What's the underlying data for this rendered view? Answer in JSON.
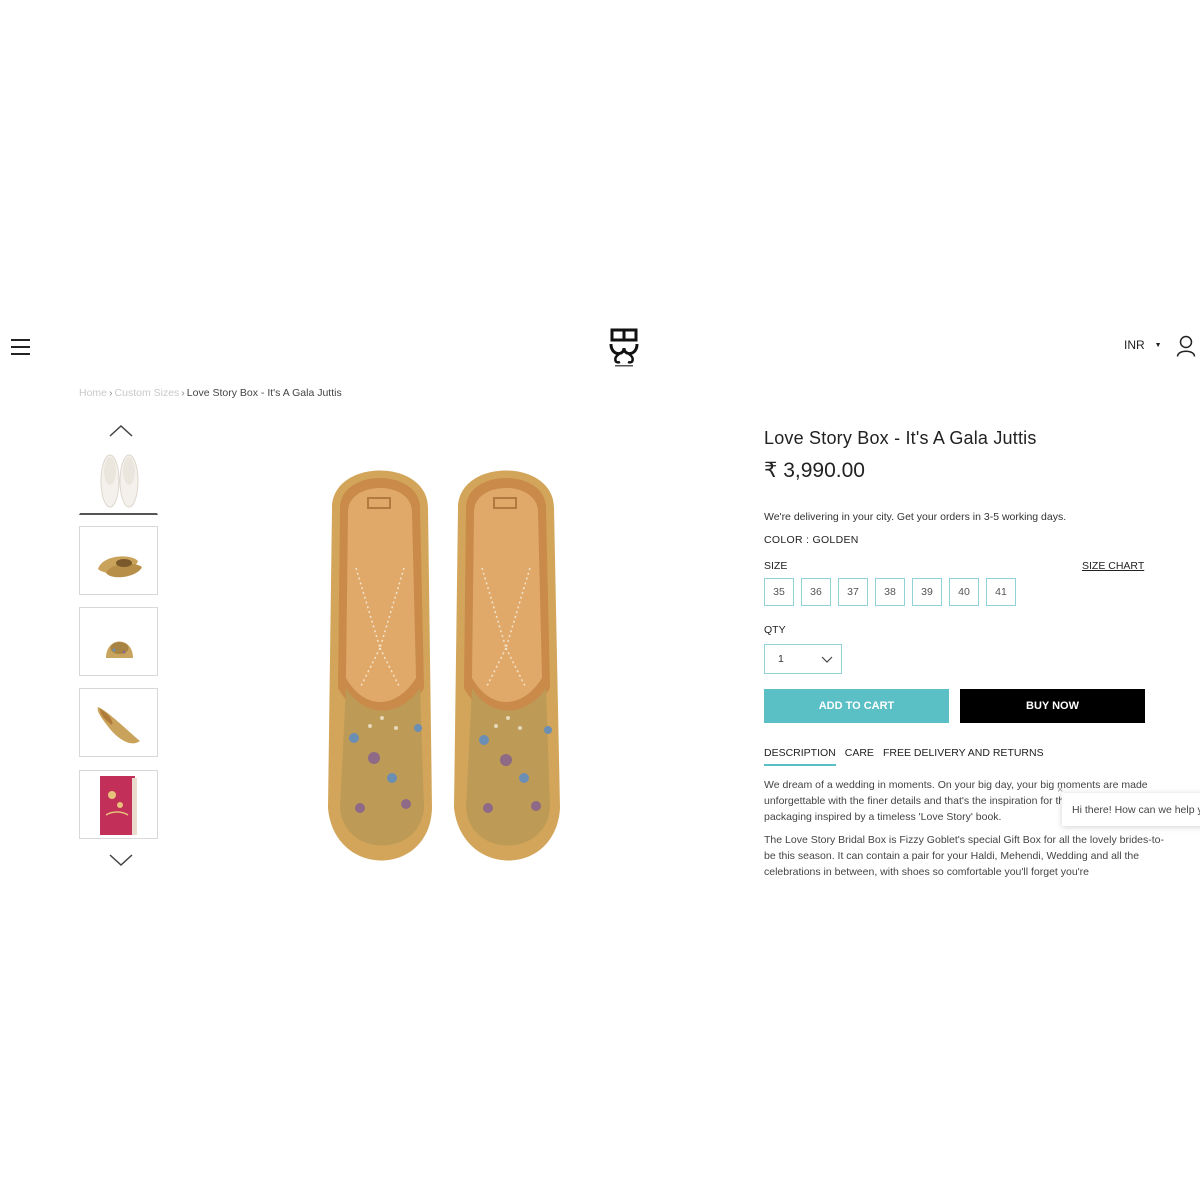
{
  "header": {
    "currency": "INR",
    "icons": {
      "menu": "hamburger-icon",
      "logo": "brand-logo",
      "account": "user-icon",
      "caret": "caret-down-icon"
    }
  },
  "breadcrumb": {
    "items": [
      "Home",
      "Custom Sizes",
      "Love Story Box - It's A Gala Juttis"
    ],
    "separator": "›"
  },
  "gallery": {
    "thumbnails": [
      "white-pair",
      "gold-pair-side",
      "gold-front",
      "gold-single-side",
      "gift-box"
    ],
    "active_index": 0,
    "icons": {
      "up": "chevron-up-icon",
      "down": "chevron-down-icon"
    }
  },
  "product": {
    "title": "Love Story Box - It's A Gala Juttis",
    "price": "₹ 3,990.00",
    "delivery_note": "We're delivering in your city. Get your orders in 3-5 working days.",
    "color_label": "COLOR : GOLDEN",
    "size_label": "SIZE",
    "size_chart_label": "SIZE CHART",
    "sizes": [
      "35",
      "36",
      "37",
      "38",
      "39",
      "40",
      "41"
    ],
    "qty_label": "QTY",
    "qty_value": "1",
    "add_to_cart": "ADD TO CART",
    "buy_now": "BUY NOW"
  },
  "tabs": {
    "items": [
      "DESCRIPTION",
      "CARE",
      "FREE DELIVERY AND RETURNS"
    ],
    "active_index": 0
  },
  "description": {
    "p1": "We dream of a wedding in moments. On your big day, your big moments are made unforgettable with the finer details and that's the inspiration for this beautiful packaging inspired by a timeless 'Love Story' book.",
    "p2": "The Love Story Bridal Box is Fizzy Goblet's special Gift Box for all the lovely brides-to-be this season. It can contain a pair for your Haldi, Mehendi, Wedding and all the celebrations in between, with shoes so comfortable you'll forget you're"
  },
  "chat": {
    "message": "Hi there! How can we help you?",
    "close": "×"
  },
  "colors": {
    "accent": "#5bbfc6",
    "buy_now": "#000000",
    "size_border": "#8fd2d8"
  }
}
